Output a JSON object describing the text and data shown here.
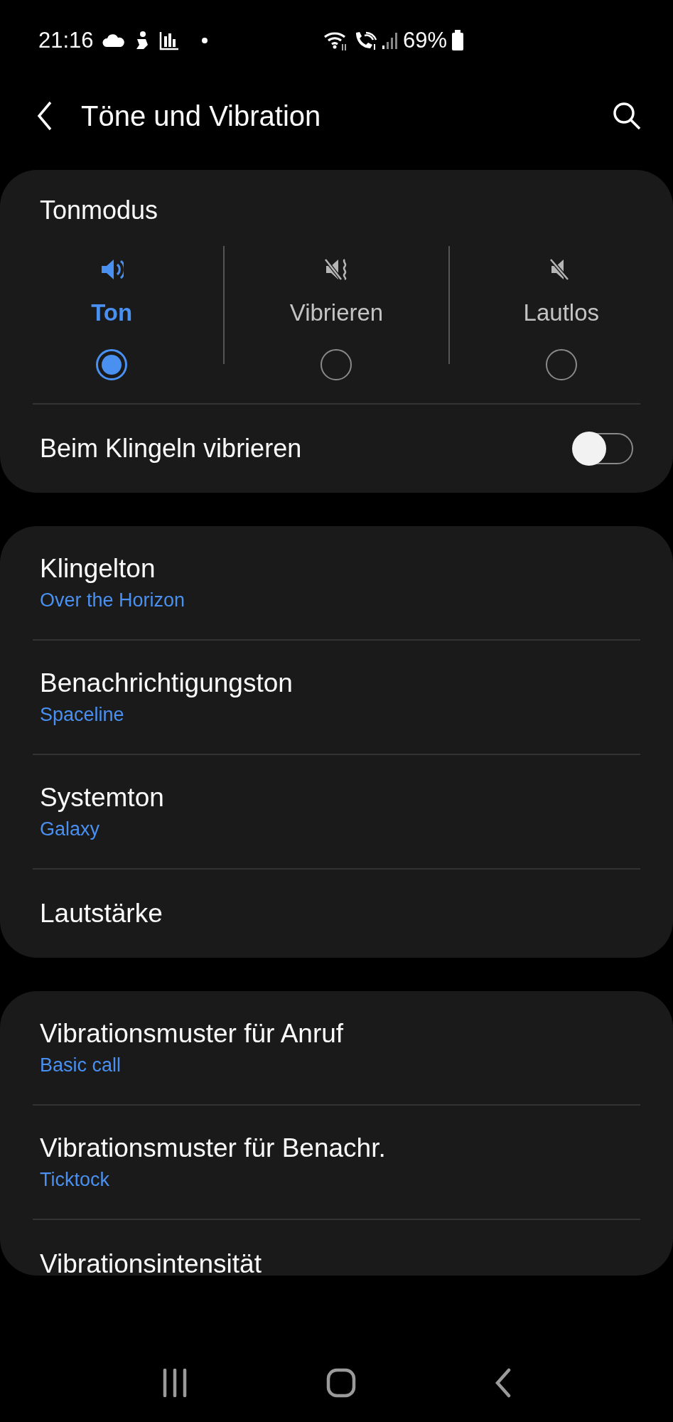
{
  "status_bar": {
    "time": "21:16",
    "battery": "69%"
  },
  "header": {
    "title": "Töne und Vibration"
  },
  "sound_mode": {
    "title": "Tonmodus",
    "modes": [
      {
        "kind": "sound",
        "label": "Ton",
        "selected": true
      },
      {
        "kind": "vibrate",
        "label": "Vibrieren",
        "selected": false
      },
      {
        "kind": "mute",
        "label": "Lautlos",
        "selected": false
      }
    ],
    "vibrate_on_ring": {
      "label": "Beim Klingeln vibrieren",
      "on": false
    }
  },
  "sound_settings": [
    {
      "title": "Klingelton",
      "value": "Over the Horizon"
    },
    {
      "title": "Benachrichtigungston",
      "value": "Spaceline"
    },
    {
      "title": "Systemton",
      "value": "Galaxy"
    },
    {
      "title": "Lautstärke"
    }
  ],
  "vibration_settings": [
    {
      "title": "Vibrationsmuster für Anruf",
      "value": "Basic call"
    },
    {
      "title": "Vibrationsmuster für Benachr.",
      "value": "Ticktock"
    },
    {
      "title": "Vibrationsintensität"
    }
  ]
}
